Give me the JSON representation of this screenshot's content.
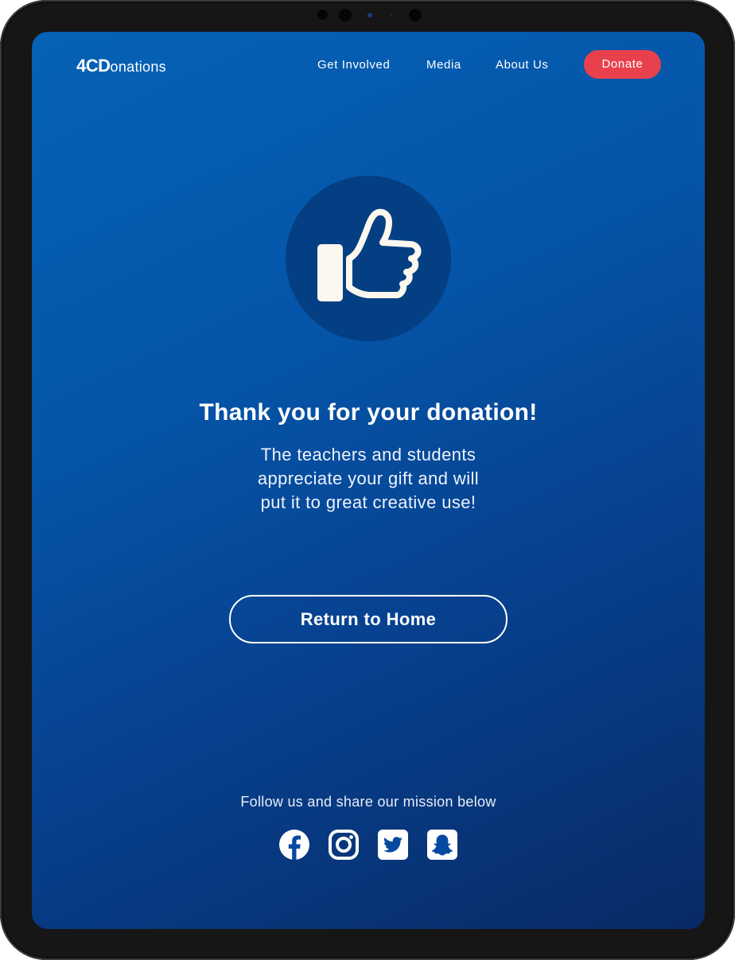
{
  "nav": {
    "logo_strong": "4CD",
    "logo_rest": "onations",
    "links": [
      "Get Involved",
      "Media",
      "About Us"
    ],
    "donate_label": "Donate"
  },
  "main": {
    "title": "Thank you for your donation!",
    "message_lines": [
      "The teachers and students",
      "appreciate your gift and will",
      "put it to great creative use!"
    ],
    "return_label": "Return to Home"
  },
  "footer": {
    "follow_text": "Follow us  and share our mission below",
    "social_icons": [
      "facebook-icon",
      "instagram-icon",
      "twitter-icon",
      "snapchat-icon"
    ]
  },
  "icons": {
    "hero": "thumbs-up-icon"
  },
  "colors": {
    "background_top": "#0562b6",
    "background_bottom": "#082a66",
    "donate_button": "#e9404d",
    "thumb_circle": "#033f82",
    "thumb_fill": "#fdf8ef"
  }
}
